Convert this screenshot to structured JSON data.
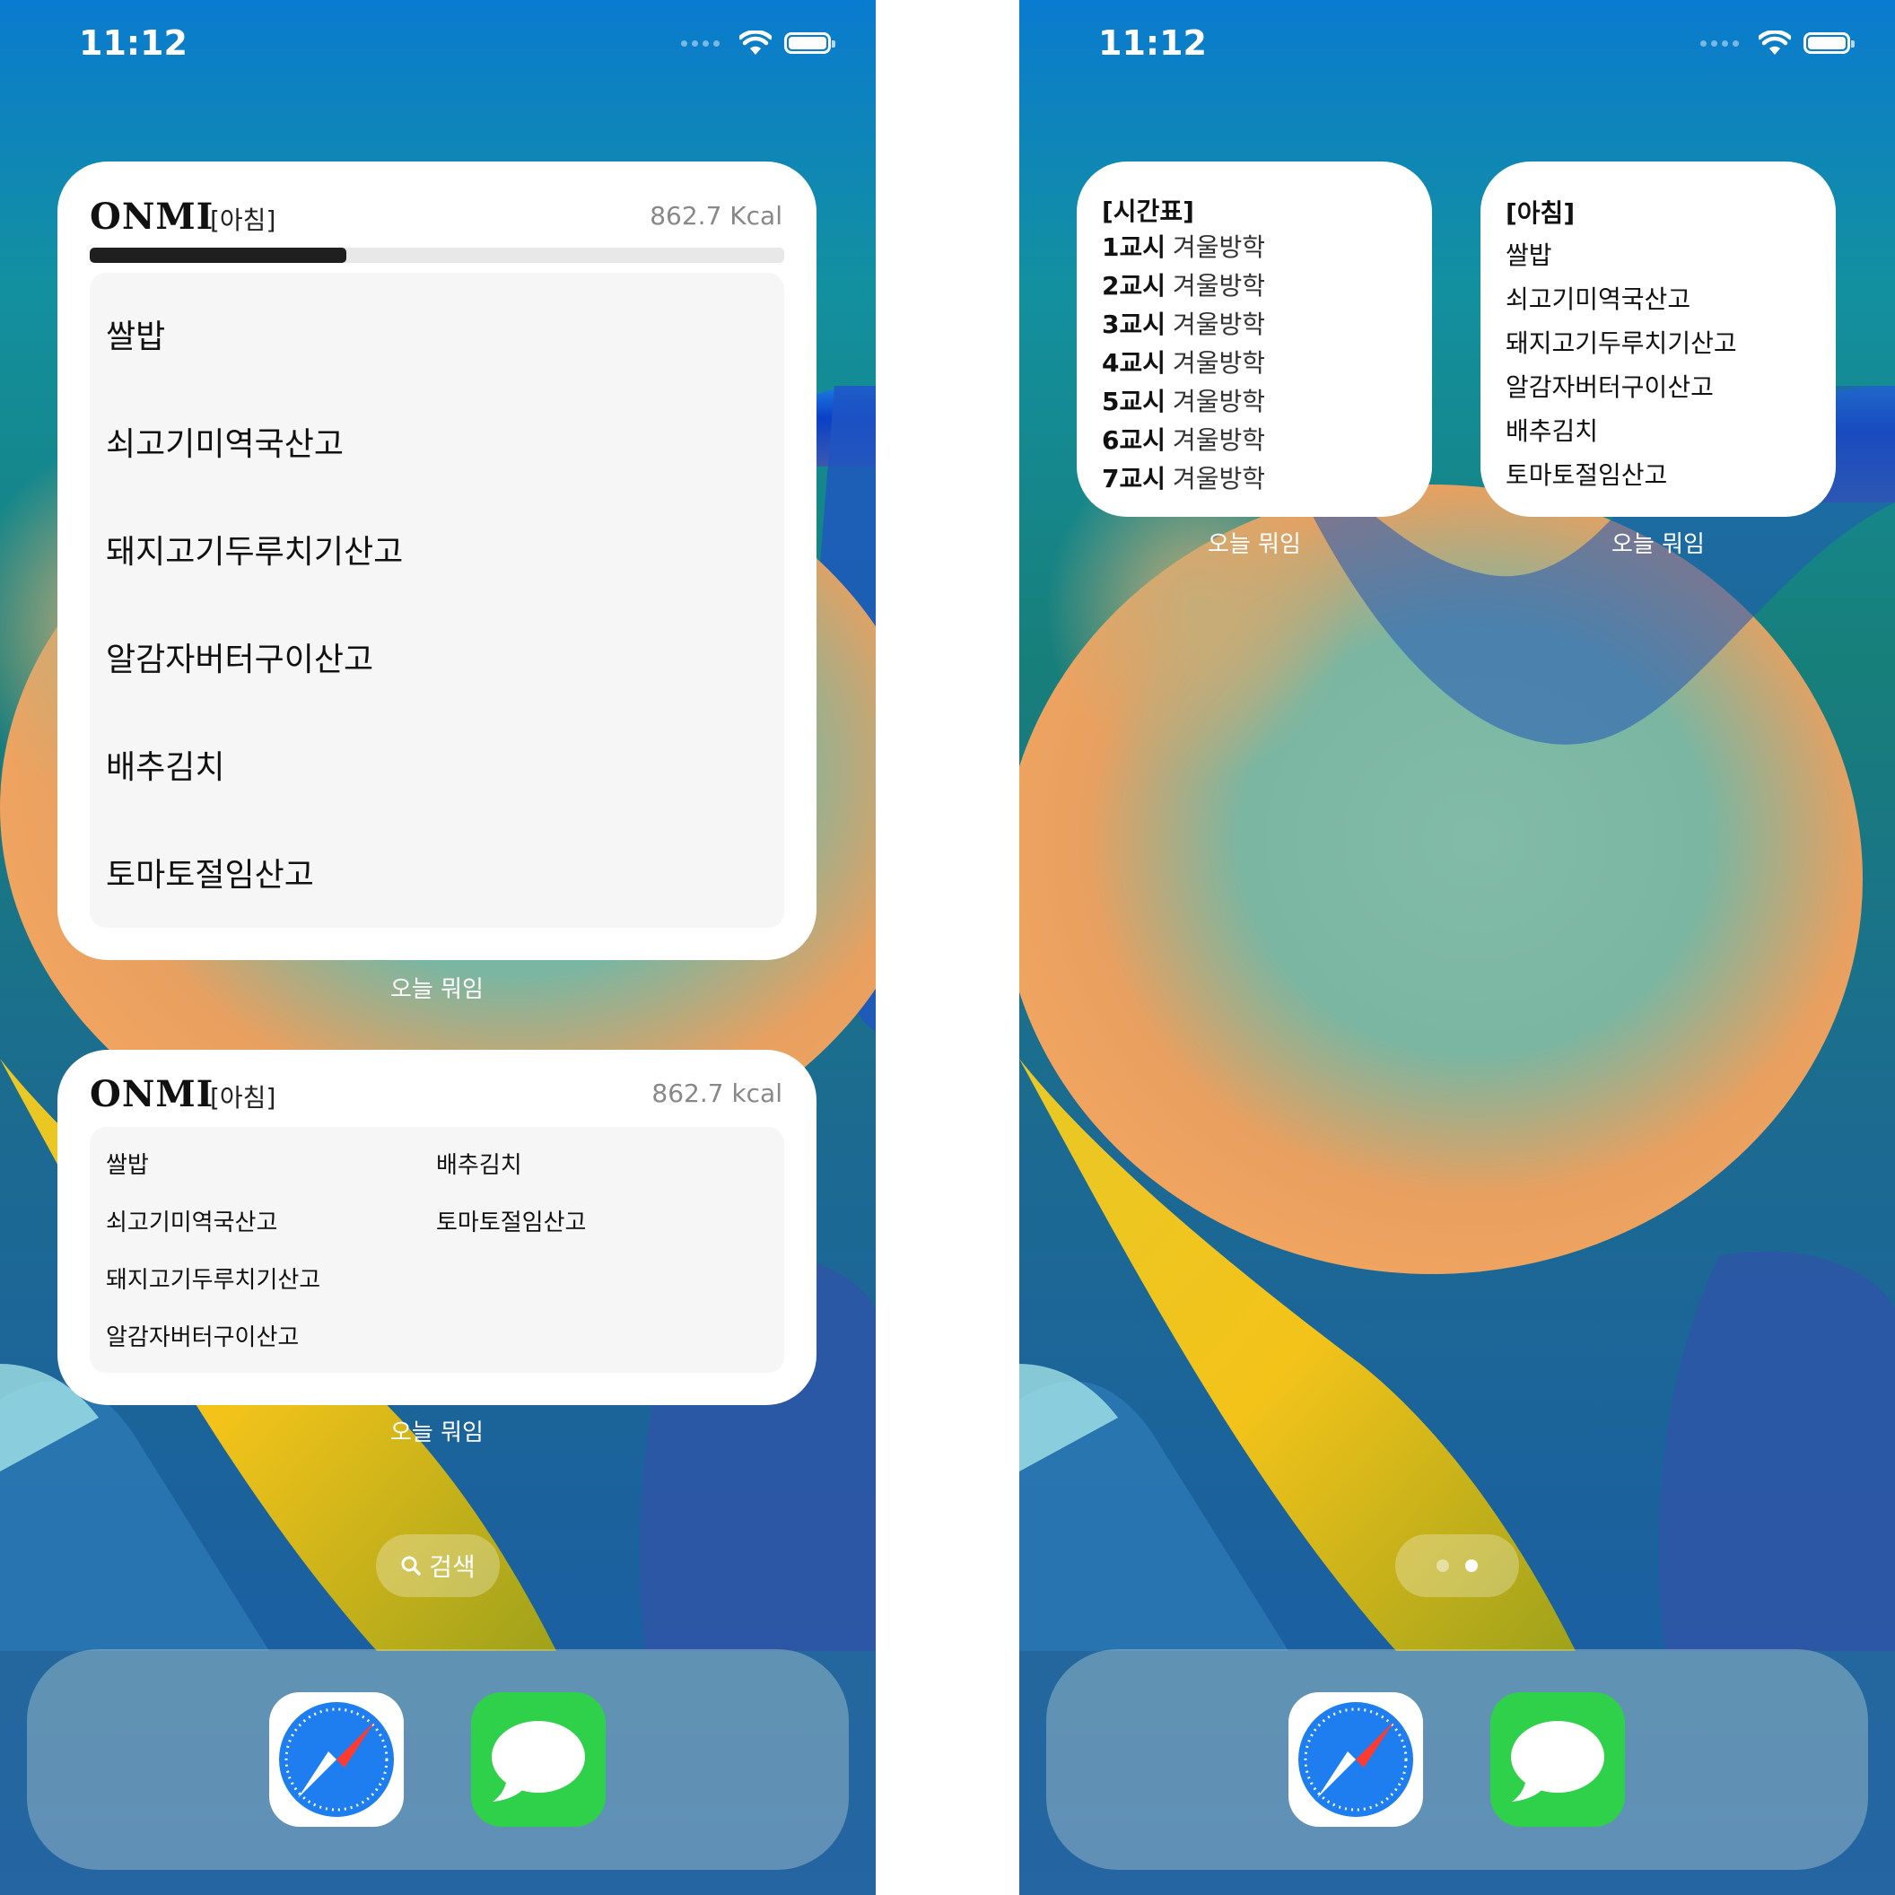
{
  "status": {
    "time": "11:12"
  },
  "widget_label": "오늘 뭐임",
  "brand": "ONMI",
  "large_widget": {
    "meal": "[아침]",
    "kcal": "862.7 Kcal",
    "progress_fraction": 0.37,
    "items": [
      "쌀밥",
      "쇠고기미역국산고",
      "돼지고기두루치기산고",
      "알감자버터구이산고",
      "배추김치",
      "토마토절임산고"
    ]
  },
  "medium_widget": {
    "meal": "[아침]",
    "kcal": "862.7 kcal",
    "col1": [
      "쌀밥",
      "쇠고기미역국산고",
      "돼지고기두루치기산고",
      "알감자버터구이산고"
    ],
    "col2": [
      "배추김치",
      "토마토절임산고"
    ]
  },
  "search_label": "검색",
  "timetable_widget": {
    "title": "[시간표]",
    "rows": [
      {
        "period": "1교시",
        "subject": "겨울방학"
      },
      {
        "period": "2교시",
        "subject": "겨울방학"
      },
      {
        "period": "3교시",
        "subject": "겨울방학"
      },
      {
        "period": "4교시",
        "subject": "겨울방학"
      },
      {
        "period": "5교시",
        "subject": "겨울방학"
      },
      {
        "period": "6교시",
        "subject": "겨울방학"
      },
      {
        "period": "7교시",
        "subject": "겨울방학"
      }
    ]
  },
  "small_meal_widget": {
    "title": "[아침]",
    "items": [
      "쌀밥",
      "쇠고기미역국산고",
      "돼지고기두루치기산고",
      "알감자버터구이산고",
      "배추김치",
      "토마토절임산고"
    ]
  },
  "page_indicator": {
    "count": 2,
    "active_index": 1
  },
  "dock_apps": [
    {
      "name": "Safari",
      "icon": "safari-icon"
    },
    {
      "name": "Messages",
      "icon": "messages-icon"
    }
  ],
  "colors": {
    "progress_fill": "#1f1f1f",
    "progress_track": "#e8e8e8",
    "messages_green": "#2fd14b",
    "safari_blue": "#1e7ef0"
  }
}
